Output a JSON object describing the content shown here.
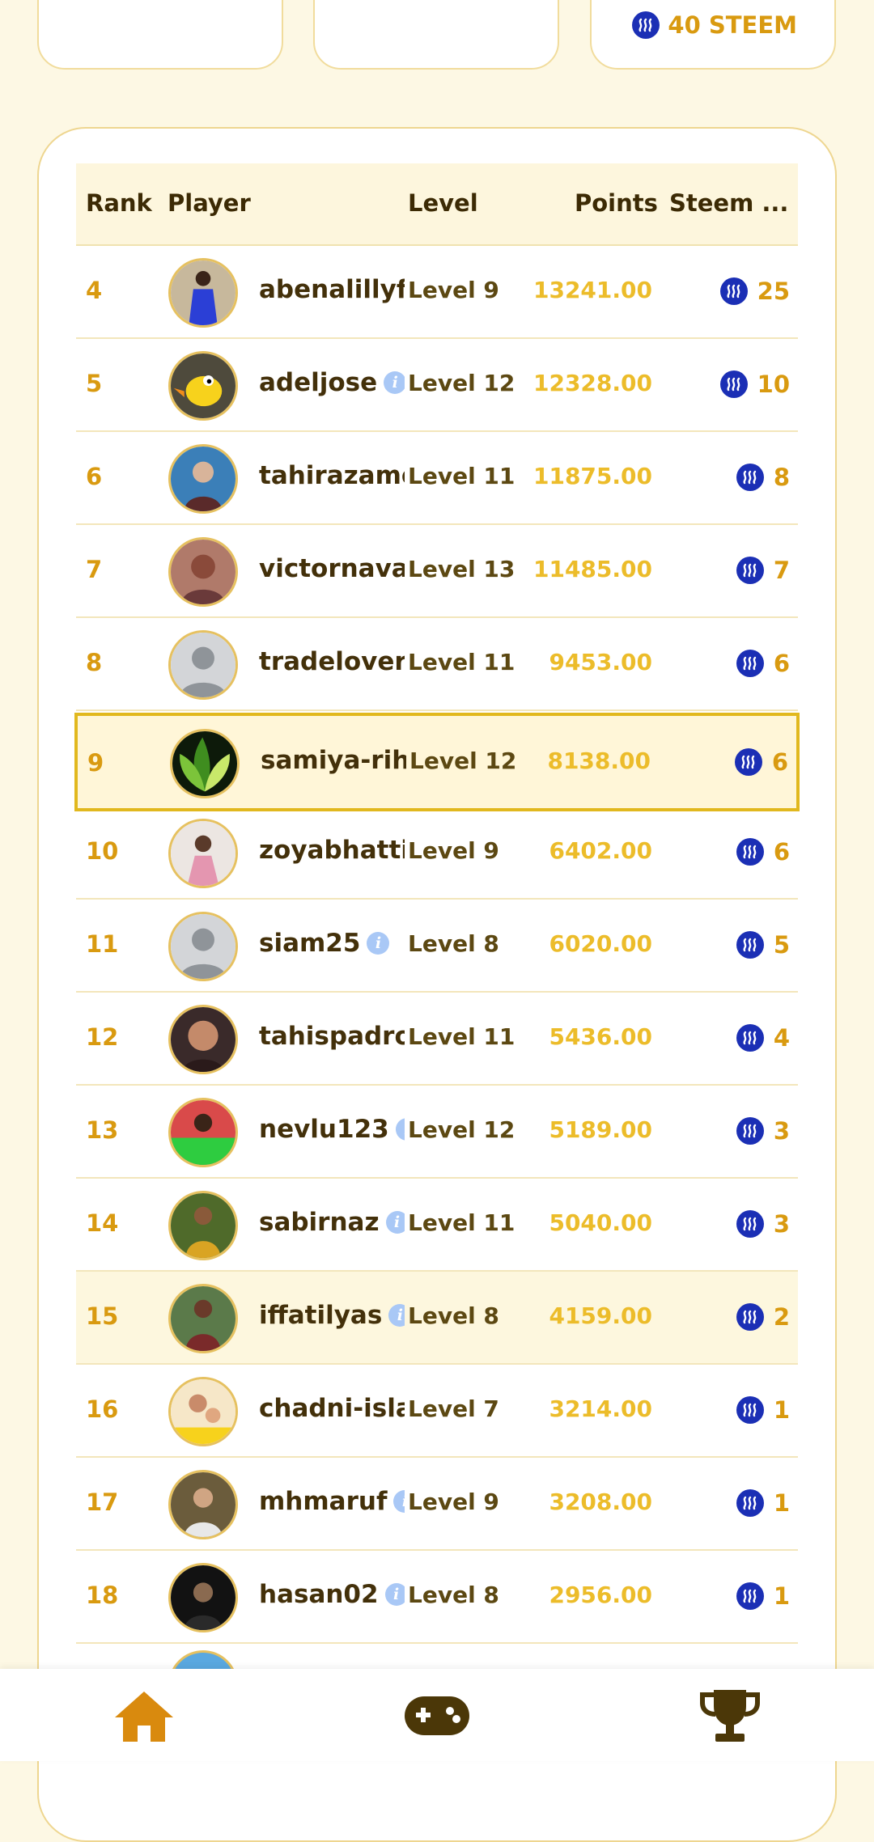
{
  "summary_cards": {
    "third_card": {
      "amount": "40 STEEM",
      "icon": "steem-icon"
    }
  },
  "colors": {
    "accent_gold": "#d99a10",
    "points_gold": "#ecbc2a",
    "steem_blue": "#1b2fb5",
    "background": "#fdf8e4",
    "highlight_border": "#e1b81e"
  },
  "leaderboard": {
    "columns": [
      "Rank",
      "Player",
      "Level",
      "Points",
      "Steem ..."
    ],
    "rows": [
      {
        "rank": "4",
        "player": "abenalillyf",
        "info": false,
        "level": "Level 9",
        "points": "13241.00",
        "steem": "25",
        "avatar": "photo-purple-dress"
      },
      {
        "rank": "5",
        "player": "adeljose",
        "info": true,
        "level": "Level 12",
        "points": "12328.00",
        "steem": "10",
        "avatar": "cartoon-bird"
      },
      {
        "rank": "6",
        "player": "tahirazame",
        "info": false,
        "level": "Level 11",
        "points": "11875.00",
        "steem": "8",
        "avatar": "photo-child"
      },
      {
        "rank": "7",
        "player": "victornava",
        "info": false,
        "level": "Level 13",
        "points": "11485.00",
        "steem": "7",
        "avatar": "photo-portrait"
      },
      {
        "rank": "8",
        "player": "tradelover",
        "info": false,
        "level": "Level 11",
        "points": "9453.00",
        "steem": "6",
        "avatar": "default-person"
      },
      {
        "rank": "9",
        "player": "samiya-rih",
        "info": false,
        "level": "Level 12",
        "points": "8138.00",
        "steem": "6",
        "avatar": "green-leaves",
        "current": true
      },
      {
        "rank": "10",
        "player": "zoyabhatti",
        "info": false,
        "level": "Level 9",
        "points": "6402.00",
        "steem": "6",
        "avatar": "photo-girl"
      },
      {
        "rank": "11",
        "player": "siam25",
        "info": true,
        "level": "Level 8",
        "points": "6020.00",
        "steem": "5",
        "avatar": "default-person"
      },
      {
        "rank": "12",
        "player": "tahispadro",
        "info": false,
        "level": "Level 11",
        "points": "5436.00",
        "steem": "4",
        "avatar": "photo-woman"
      },
      {
        "rank": "13",
        "player": "nevlu123",
        "info": true,
        "level": "Level 12",
        "points": "5189.00",
        "steem": "3",
        "avatar": "photo-green-banner"
      },
      {
        "rank": "14",
        "player": "sabirnaz",
        "info": true,
        "level": "Level 11",
        "points": "5040.00",
        "steem": "3",
        "avatar": "photo-man-outdoor"
      },
      {
        "rank": "15",
        "player": "iffatilyas",
        "info": true,
        "level": "Level 8",
        "points": "4159.00",
        "steem": "2",
        "avatar": "photo-woman-green",
        "alt": true
      },
      {
        "rank": "16",
        "player": "chadni-isla",
        "info": false,
        "level": "Level 7",
        "points": "3214.00",
        "steem": "1",
        "avatar": "photo-mother-child"
      },
      {
        "rank": "17",
        "player": "mhmaruf",
        "info": true,
        "level": "Level 9",
        "points": "3208.00",
        "steem": "1",
        "avatar": "photo-man-beard"
      },
      {
        "rank": "18",
        "player": "hasan02",
        "info": true,
        "level": "Level 8",
        "points": "2956.00",
        "steem": "1",
        "avatar": "photo-man-dark"
      }
    ]
  },
  "bottom_nav": {
    "items": [
      {
        "name": "home",
        "icon": "home-icon",
        "active": true
      },
      {
        "name": "games",
        "icon": "gamepad-icon"
      },
      {
        "name": "leaderboard",
        "icon": "trophy-icon"
      }
    ]
  }
}
